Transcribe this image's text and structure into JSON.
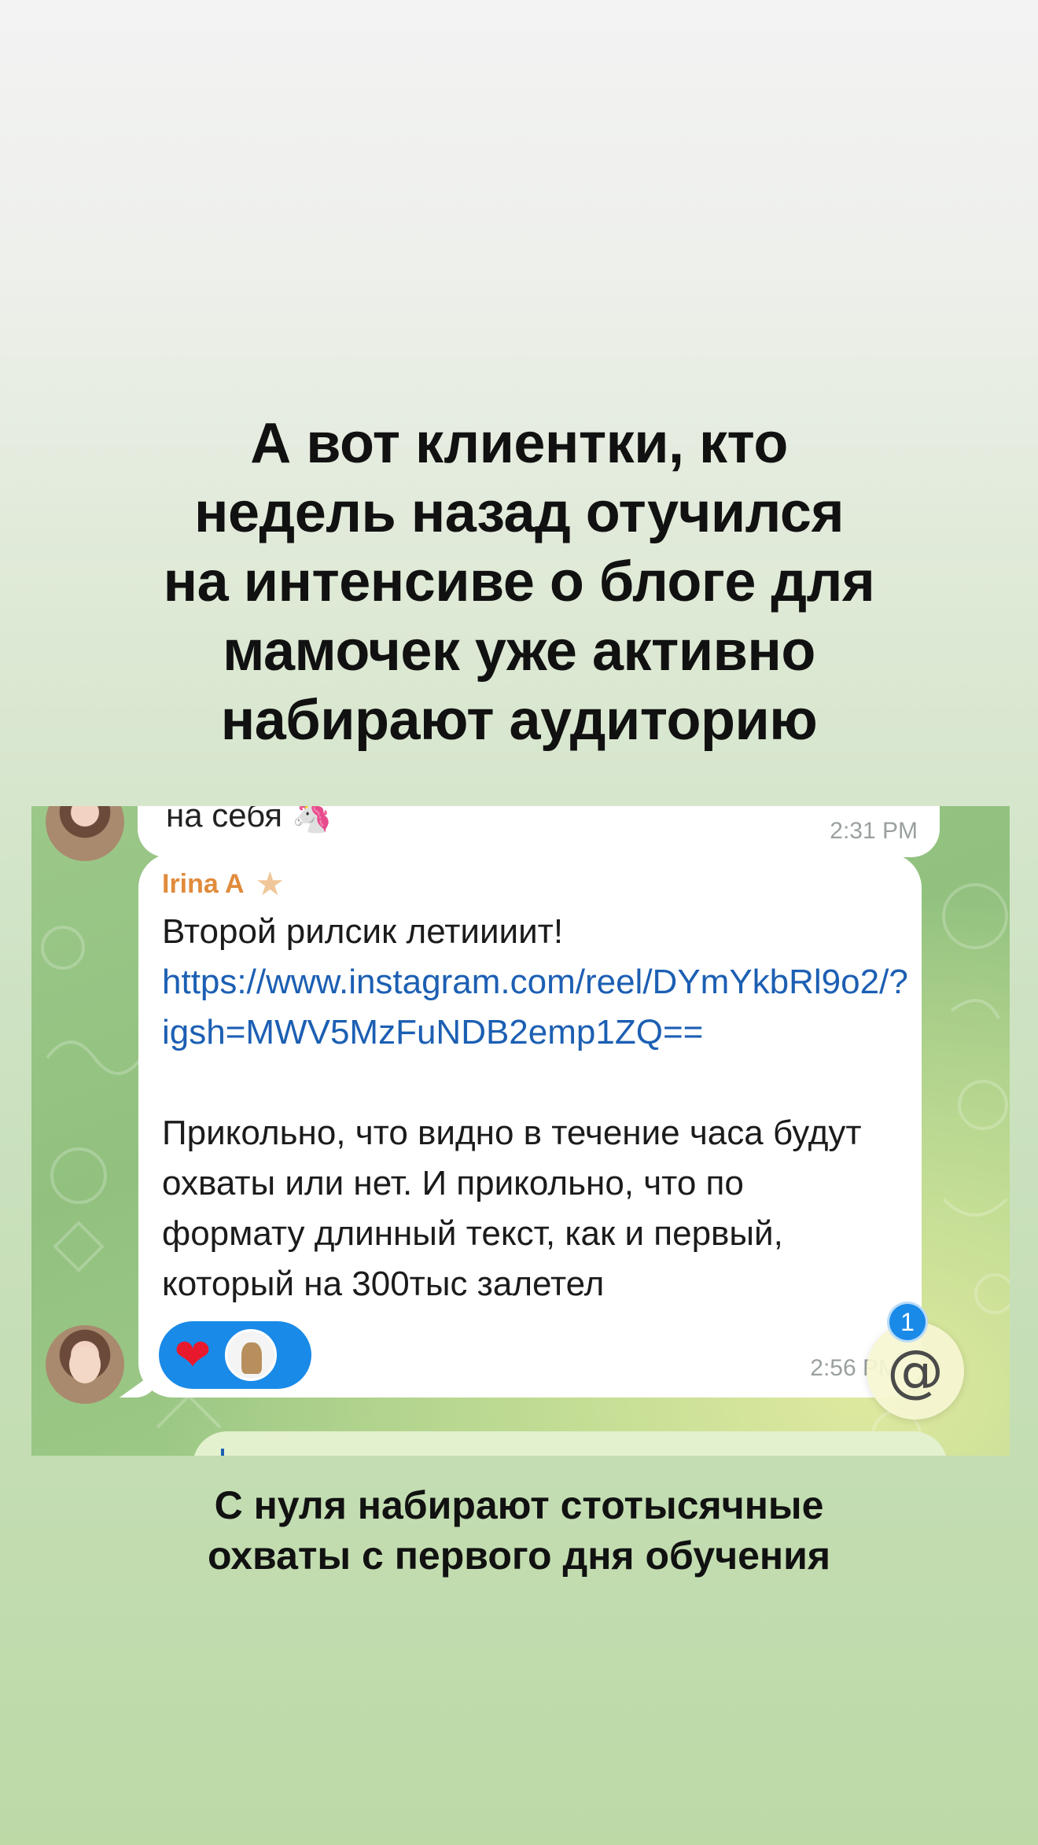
{
  "headline": {
    "lines": [
      "А вот клиентки, кто",
      "недель назад отучился",
      "на интенсиве о блоге для",
      "мамочек уже активно",
      "набирают аудиторию"
    ]
  },
  "chat": {
    "prev_message": {
      "partial_text": "на себя 🦄",
      "time": "2:31 PM"
    },
    "message": {
      "sender": "Irina A",
      "sender_icon": "star-icon",
      "text_intro": "Второй рилсик летиииит! ",
      "link": "https://www.instagram.com/reel/DYmYkbRl9o2/?igsh=MWV5MzFuNDB2emp1ZQ==",
      "text_body": "Прикольно, что видно в течение часа будут охваты или нет. И прикольно, что по формату длинный текст, как и первый, который на 300тыс залетел",
      "time": "2:56 PM",
      "reactions": [
        {
          "icon": "heart-icon",
          "glyph": "❤"
        }
      ]
    },
    "mention_button": {
      "glyph": "@",
      "badge_count": "1"
    }
  },
  "subhead": {
    "lines": [
      "С нуля набирают стотысячные",
      "охваты с первого дня обучения"
    ]
  },
  "colors": {
    "link": "#1c5fb3",
    "sender": "#e08b3c",
    "reaction_pill": "#1a8ae8",
    "heart": "#e8192c"
  }
}
